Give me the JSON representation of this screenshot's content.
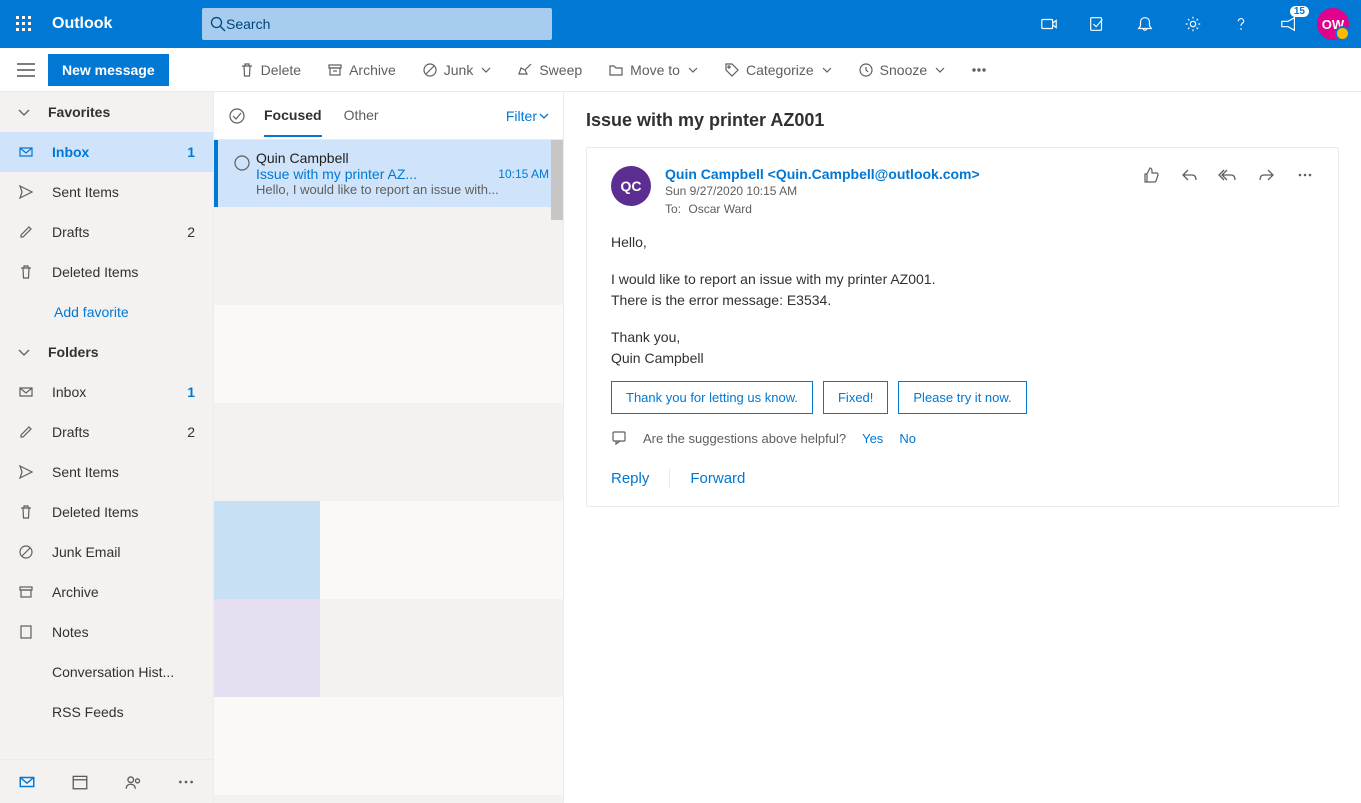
{
  "brand": "Outlook",
  "search_placeholder": "Search",
  "topbar": {
    "notification_count": "15",
    "avatar_initials": "OW"
  },
  "cmdbar": {
    "new_message": "New message",
    "delete": "Delete",
    "archive": "Archive",
    "junk": "Junk",
    "sweep": "Sweep",
    "move_to": "Move to",
    "categorize": "Categorize",
    "snooze": "Snooze"
  },
  "sidebar": {
    "favorites_label": "Favorites",
    "folders_label": "Folders",
    "add_favorite": "Add favorite",
    "fav": [
      {
        "label": "Inbox",
        "count": "1"
      },
      {
        "label": "Sent Items",
        "count": ""
      },
      {
        "label": "Drafts",
        "count": "2"
      },
      {
        "label": "Deleted Items",
        "count": ""
      }
    ],
    "folders": [
      {
        "label": "Inbox",
        "count": "1"
      },
      {
        "label": "Drafts",
        "count": "2"
      },
      {
        "label": "Sent Items",
        "count": ""
      },
      {
        "label": "Deleted Items",
        "count": ""
      },
      {
        "label": "Junk Email",
        "count": ""
      },
      {
        "label": "Archive",
        "count": ""
      },
      {
        "label": "Notes",
        "count": ""
      },
      {
        "label": "Conversation Hist...",
        "count": ""
      },
      {
        "label": "RSS Feeds",
        "count": ""
      }
    ]
  },
  "list": {
    "tab_focused": "Focused",
    "tab_other": "Other",
    "filter": "Filter",
    "items": [
      {
        "from": "Quin Campbell",
        "subject": "Issue with my printer AZ...",
        "time": "10:15 AM",
        "preview": "Hello, I would like to report an issue with..."
      }
    ]
  },
  "reading": {
    "subject": "Issue with my printer AZ001",
    "sender_initials": "QC",
    "sender_display": "Quin Campbell <Quin.Campbell@outlook.com>",
    "date": "Sun 9/27/2020 10:15 AM",
    "to_label": "To:",
    "to_value": "Oscar Ward",
    "body_lines": [
      "Hello,",
      "I would like to report an issue with my printer AZ001.\nThere is the error message: E3534.",
      "Thank you,\nQuin Campbell"
    ],
    "suggestions": [
      "Thank you for letting us know.",
      "Fixed!",
      "Please try it now."
    ],
    "feedback_prompt": "Are the suggestions above helpful?",
    "feedback_yes": "Yes",
    "feedback_no": "No",
    "reply": "Reply",
    "forward": "Forward"
  }
}
